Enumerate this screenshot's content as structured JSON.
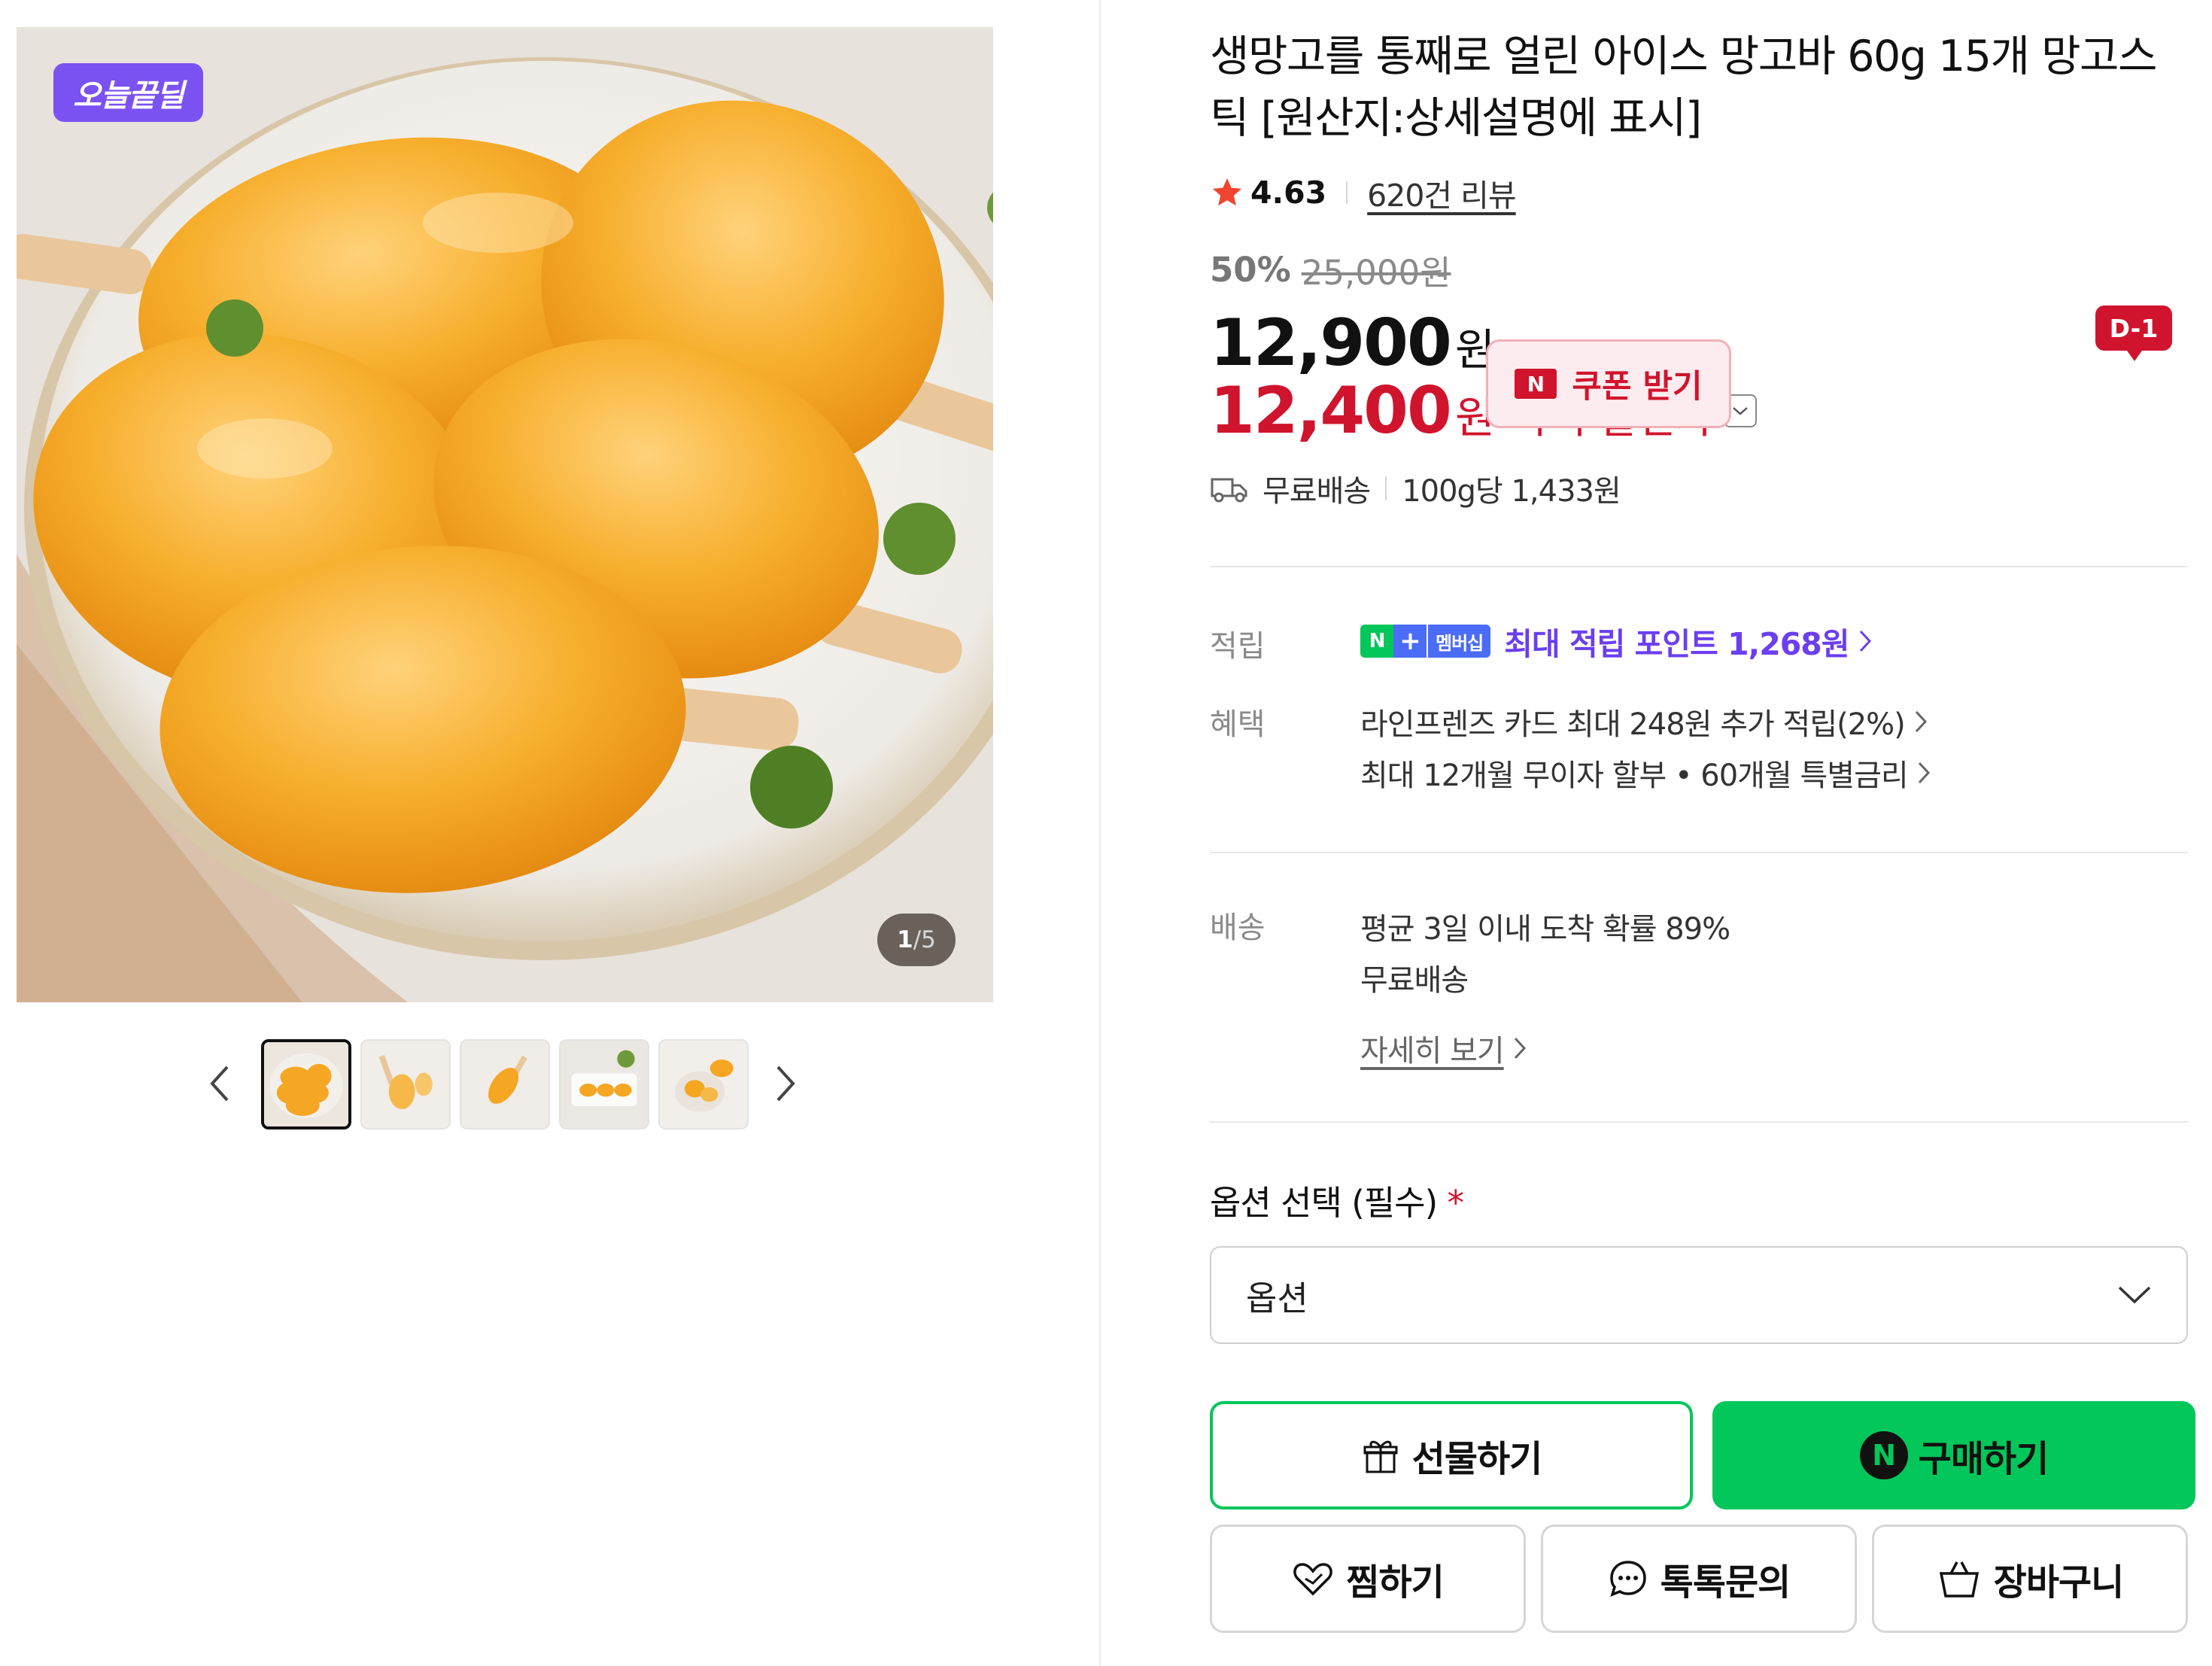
{
  "gallery": {
    "badge": "오늘끝딜",
    "counter_current": "1",
    "counter_total": "/5",
    "thumbnail_count": 5,
    "active_thumbnail": 1
  },
  "product": {
    "title": "생망고를 통째로 얼린 아이스 망고바 60g 15개 망고스틱 [원산지:상세설명에 표시]",
    "rating": "4.63",
    "review_count": "620건 리뷰",
    "discount_rate": "50%",
    "original_price": "25,000원",
    "price": "12,900",
    "currency": "원",
    "my_discount_price": "12,400",
    "my_discount_label": "나의 할인가",
    "shipping": "무료배송",
    "unit_price": "100g당 1,433원"
  },
  "coupon": {
    "dday": "D-1",
    "logo": "N",
    "label": "쿠폰 받기"
  },
  "benefits": {
    "points_label": "적립",
    "npay_n": "N",
    "npay_plus": "+",
    "npay_membership": "멤버십",
    "points_text": "최대 적립 포인트 1,268원",
    "benefit_label": "혜택",
    "card_text": "라인프렌즈 카드 최대 248원 추가 적립(2%)",
    "installment_text": "최대 12개월 무이자 할부 • 60개월 특별금리"
  },
  "delivery": {
    "label": "배송",
    "arrival": "평균 3일 이내 도착 확률 89%",
    "fee": "무료배송",
    "detail_link": "자세히 보기"
  },
  "option": {
    "label": "옵션 선택 (필수)",
    "required_mark": "*",
    "selected": "옵션"
  },
  "actions": {
    "gift": "선물하기",
    "buy": "구매하기",
    "buy_logo": "N",
    "wish": "찜하기",
    "talk": "톡톡문의",
    "cart": "장바구니"
  },
  "colors": {
    "naver_green": "#03c75a",
    "sale_red": "#d0142d",
    "points_purple": "#6b3ef0",
    "badge_purple": "#7b52f2",
    "star_red": "#f04531"
  }
}
